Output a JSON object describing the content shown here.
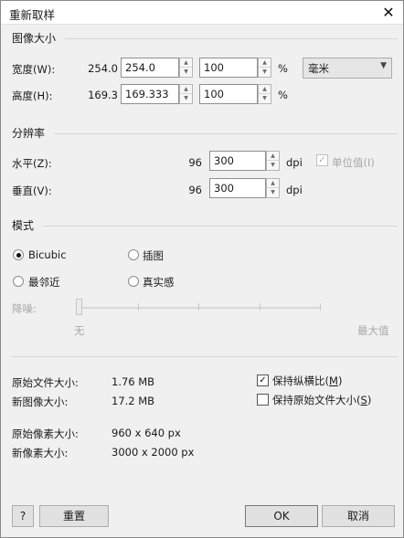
{
  "window": {
    "title": "重新取样",
    "close_glyph": "✕"
  },
  "image_size": {
    "group_title": "图像大小",
    "width": {
      "label": "宽度(W):",
      "original": "254.0",
      "value": "254.0",
      "percent": "100",
      "percent_unit": "%"
    },
    "height": {
      "label": "高度(H):",
      "original": "169.3",
      "value": "169.333",
      "percent": "100",
      "percent_unit": "%"
    },
    "unit_select": {
      "value": "毫米"
    }
  },
  "resolution": {
    "group_title": "分辨率",
    "horizontal": {
      "label": "水平(Z):",
      "original": "96",
      "value": "300",
      "unit": "dpi"
    },
    "vertical": {
      "label": "垂直(V):",
      "original": "96",
      "value": "300",
      "unit": "dpi"
    },
    "unit_value_checkbox": {
      "label": "单位值(I)",
      "checked": true,
      "enabled": false
    }
  },
  "mode": {
    "group_title": "模式",
    "options": [
      {
        "label": "Bicubic",
        "selected": true
      },
      {
        "label": "插图",
        "selected": false
      },
      {
        "label": "最邻近",
        "selected": false
      },
      {
        "label": "真实感",
        "selected": false
      }
    ],
    "noise": {
      "label": "降噪:",
      "min_label": "无",
      "max_label": "最大值",
      "value_fraction": 0
    }
  },
  "info": {
    "original_file_size": {
      "label": "原始文件大小:",
      "value": "1.76 MB"
    },
    "new_image_size": {
      "label": "新图像大小:",
      "value": "17.2 MB"
    },
    "original_pixel_size": {
      "label": "原始像素大小:",
      "value": "960 x 640 px"
    },
    "new_pixel_size": {
      "label": "新像素大小:",
      "value": "3000 x 2000 px"
    }
  },
  "options": {
    "keep_aspect": {
      "label": "保持纵横比(",
      "key": "M",
      "suffix": ")",
      "checked": true
    },
    "keep_original_size": {
      "label": "保持原始文件大小(",
      "key": "S",
      "suffix": ")",
      "checked": false
    }
  },
  "buttons": {
    "help": "?",
    "reset": "重置",
    "ok": "OK",
    "cancel": "取消"
  },
  "icons": {
    "check_glyph": "✓",
    "spin_up": "▲",
    "spin_down": "▼",
    "dropdown": "▼"
  }
}
